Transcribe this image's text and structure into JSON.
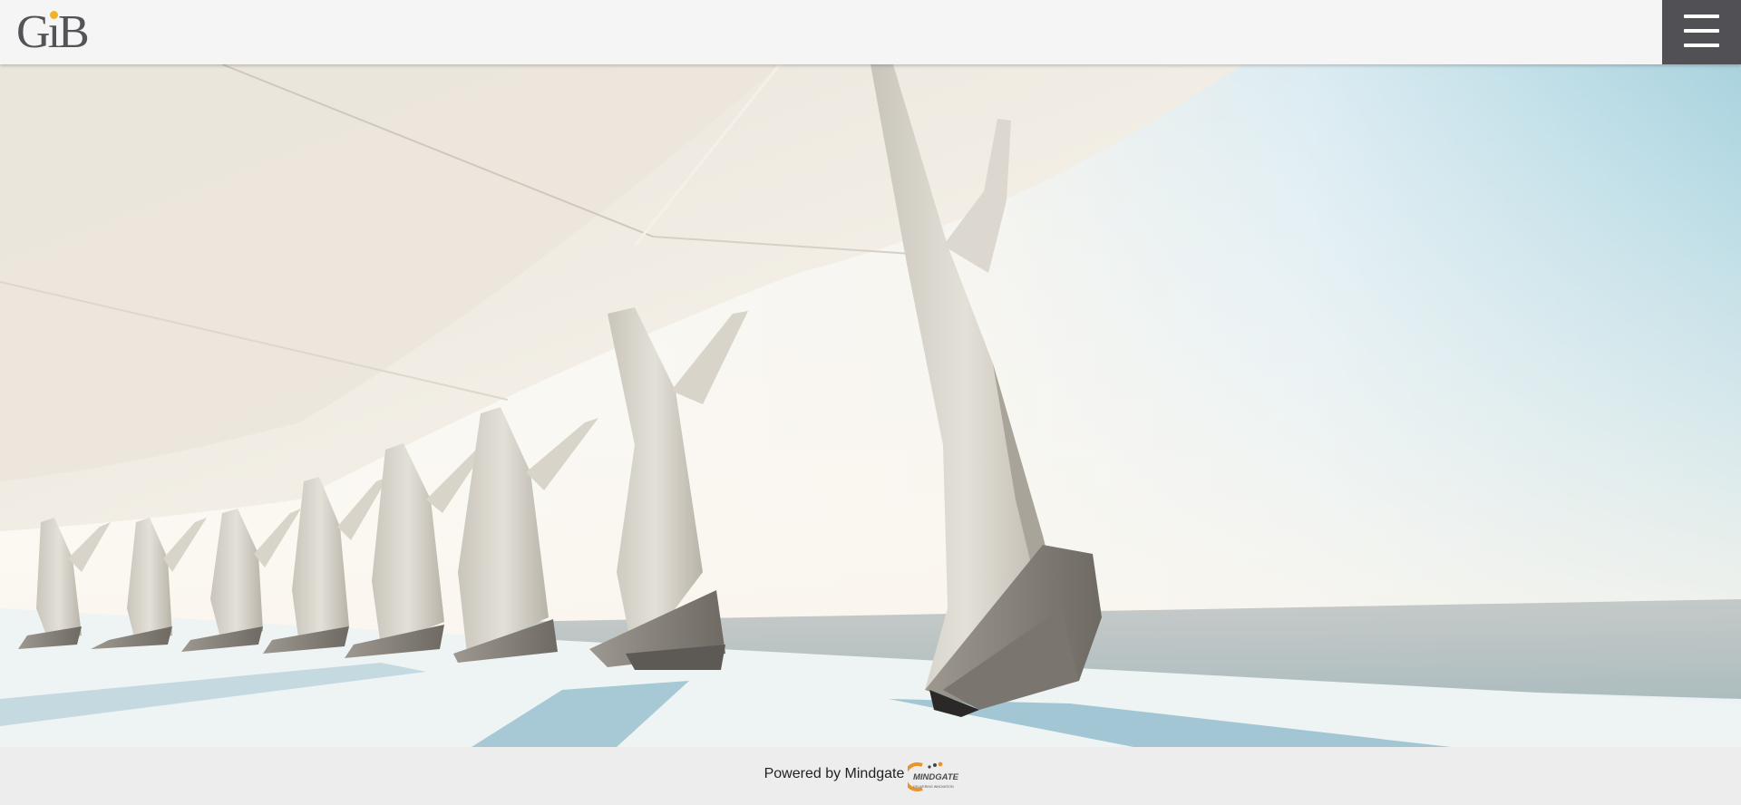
{
  "header": {
    "logo_text": "GiB",
    "menu_icon": "hamburger-menu-icon"
  },
  "hero": {
    "image": "architectural-colonnade-photo"
  },
  "footer": {
    "powered_by": "Powered by Mindgate",
    "partner_logo_text": "MINDGATE",
    "partner_tagline": "DELIVERING INNOVATION"
  },
  "colors": {
    "header_bg": "#f5f5f5",
    "menu_button_bg": "#505055",
    "logo_text": "#555357",
    "logo_accent": "#f0b323",
    "footer_bg": "#ededed",
    "mindgate_orange": "#e8942a"
  }
}
